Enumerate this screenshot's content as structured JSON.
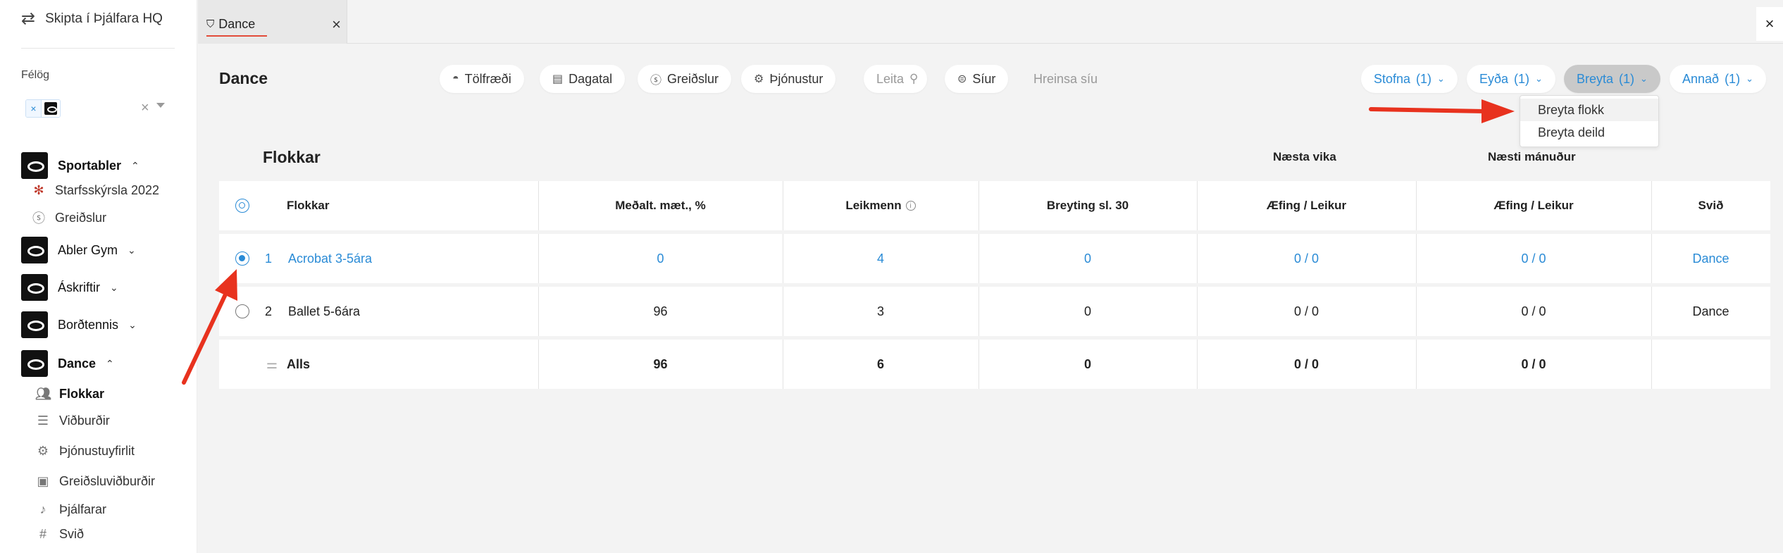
{
  "sidebar": {
    "switch_label": "Skipta í Þjálfara HQ",
    "felog_label": "Félög",
    "felog_chip_remove": "×",
    "felog_clear": "×",
    "groups": [
      {
        "label": "Sportabler",
        "chevron": "^",
        "children": [
          {
            "label": "Starfsskýrsla 2022",
            "icon": "olympic-icon"
          },
          {
            "label": "Greiðslur",
            "icon": "dollar-icon"
          }
        ]
      },
      {
        "label": "Abler Gym",
        "chevron": "v"
      },
      {
        "label": "Áskriftir",
        "chevron": "v"
      },
      {
        "label": "Borðtennis",
        "chevron": "v"
      },
      {
        "label": "Dance",
        "chevron": "^",
        "children": [
          {
            "label": "Flokkar",
            "icon": "users-icon",
            "active": true
          },
          {
            "label": "Viðburðir",
            "icon": "list-icon"
          },
          {
            "label": "Þjónustuyfirlit",
            "icon": "gear-icon"
          },
          {
            "label": "Greiðsluviðburðir",
            "icon": "calendar-dollar-icon"
          },
          {
            "label": "Þjálfarar",
            "icon": "whistle-icon"
          },
          {
            "label": "Svið",
            "icon": "hash-icon"
          }
        ]
      }
    ]
  },
  "tab": {
    "label": "Dance",
    "close": "×"
  },
  "window_close": "×",
  "toolbar": {
    "title": "Dance",
    "pills": [
      "Tölfræði",
      "Dagatal",
      "Greiðslur",
      "Þjónustur"
    ],
    "search_placeholder": "Leita",
    "filters": "Síur",
    "clear_filters": "Hreinsa síu",
    "actions": [
      {
        "label": "Stofna",
        "count": "(1)"
      },
      {
        "label": "Eyða",
        "count": "(1)"
      },
      {
        "label": "Breyta",
        "count": "(1)",
        "active": true
      },
      {
        "label": "Annað",
        "count": "(1)"
      }
    ]
  },
  "dropdown": {
    "items": [
      "Breyta flokk",
      "Breyta deild"
    ]
  },
  "table": {
    "section_title": "Flokkar",
    "group_headers": {
      "next_week": "Næsta vika",
      "next_month": "Næsti mánuður"
    },
    "columns": [
      "Flokkar",
      "Meðalt. mæt., %",
      "Leikmenn",
      "Breyting sl. 30",
      "Æfing / Leikur",
      "Æfing / Leikur",
      "Svið"
    ],
    "info_icon": "i",
    "rows": [
      {
        "num": "1",
        "name": "Acrobat 3-5ára",
        "avg": "0",
        "players": "4",
        "change": "0",
        "week": "0 / 0",
        "month": "0 / 0",
        "svid": "Dance",
        "selected": true
      },
      {
        "num": "2",
        "name": "Ballet 5-6ára",
        "avg": "96",
        "players": "3",
        "change": "0",
        "week": "0 / 0",
        "month": "0 / 0",
        "svid": "Dance",
        "selected": false
      }
    ],
    "total": {
      "label": "Alls",
      "avg": "96",
      "players": "6",
      "change": "0",
      "week": "0 / 0",
      "month": "0 / 0"
    }
  },
  "colors": {
    "accent": "#2a8bd6",
    "arrow": "#e8321e",
    "tab_underline": "#e24c3a"
  }
}
